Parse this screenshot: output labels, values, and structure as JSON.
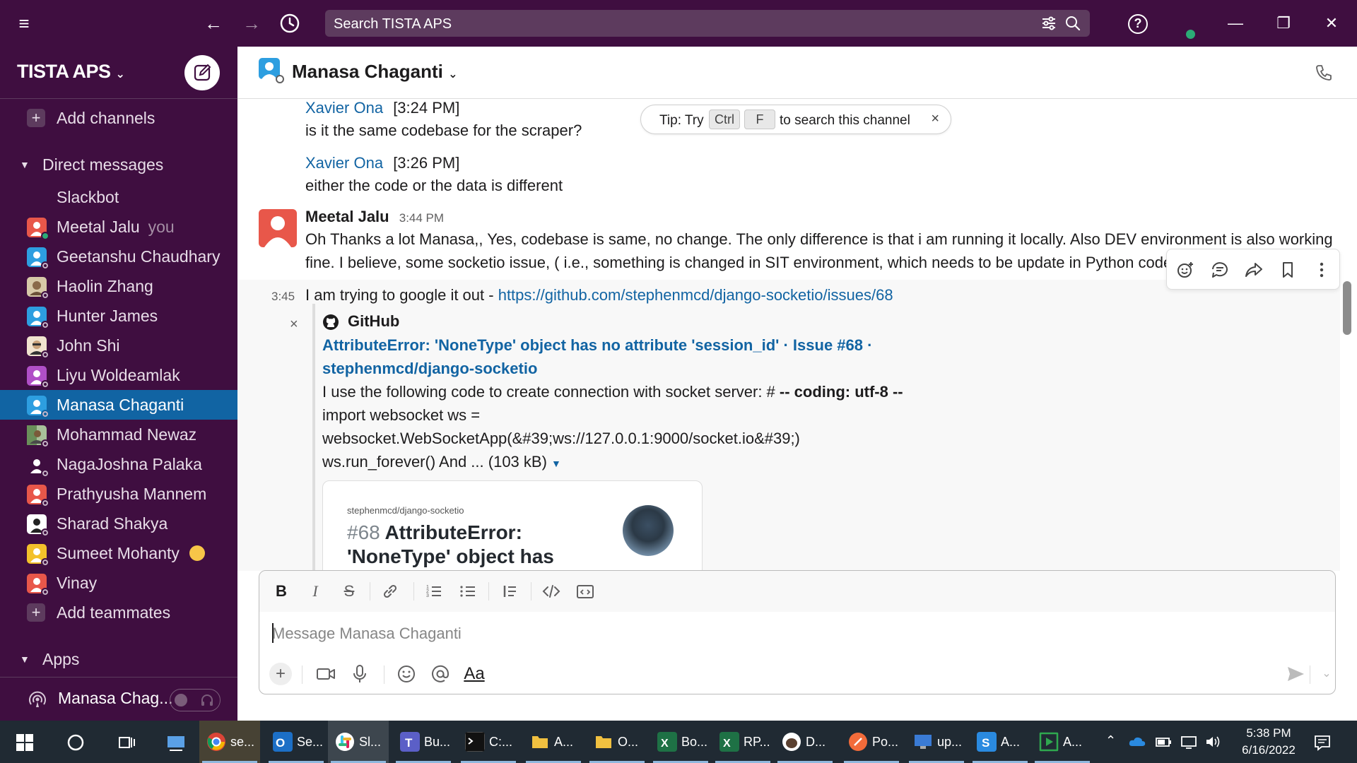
{
  "topbar": {
    "search_placeholder": "Search TISTA APS",
    "help_label": "?"
  },
  "sidebar": {
    "workspace_name": "TISTA APS",
    "add_channels": "Add channels",
    "dm_section": "Direct messages",
    "dms": [
      {
        "name": "Slackbot"
      },
      {
        "name": "Meetal Jalu",
        "suffix": "you",
        "color": "#e8574a"
      },
      {
        "name": "Geetanshu Chaudhary",
        "color": "#2d9ee0"
      },
      {
        "name": "Haolin Zhang",
        "color": "#d7c9a8"
      },
      {
        "name": "Hunter James",
        "color": "#2d9ee0"
      },
      {
        "name": "John Shi",
        "color": "#c9a27a"
      },
      {
        "name": "Liyu Woldeamlak",
        "color": "#b04fc7"
      },
      {
        "name": "Manasa Chaganti",
        "color": "#2d9ee0"
      },
      {
        "name": "Mohammad Newaz",
        "color": "#6a8f5a"
      },
      {
        "name": "NagaJoshna Palaka",
        "color": "#222222"
      },
      {
        "name": "Prathyusha Mannem",
        "color": "#e8574a"
      },
      {
        "name": "Sharad Shakya",
        "color": "#222222"
      },
      {
        "name": "Sumeet Mohanty",
        "color": "#f3c12b"
      },
      {
        "name": "Vinay",
        "color": "#e8574a"
      }
    ],
    "add_teammates": "Add teammates",
    "apps_section": "Apps",
    "footer_name": "Manasa Chag..."
  },
  "channel": {
    "title": "Manasa Chaganti"
  },
  "tip": {
    "prefix": "Tip: Try",
    "key1": "Ctrl",
    "key2": "F",
    "suffix": "to search this channel",
    "close": "×"
  },
  "messages": {
    "m1": {
      "author": "Xavier Ona",
      "time": "[3:24 PM]",
      "text": "is it the same codebase for the scraper?"
    },
    "m2": {
      "author": "Xavier Ona",
      "time": "[3:26 PM]",
      "text": "either the code or the data is different"
    },
    "m3": {
      "author": "Meetal Jalu",
      "time": "3:44 PM",
      "line1": "Oh Thanks a lot Manasa,, Yes, codebase is same, no change. The only difference is that i am running it locally. Also DEV environment is also working",
      "line2": "fine. I believe, some socketio issue, ( i.e., something is changed in SIT environment, which needs to be update in Python code"
    },
    "m4": {
      "time": "3:45",
      "text_prefix": "I am trying to google it out - ",
      "link": "https://github.com/stephenmcd/django-socketio/issues/68",
      "dismiss": "×",
      "unfurl": {
        "source": "GitHub",
        "title_line1": "AttributeError: 'NoneType' object has no attribute 'session_id' · Issue #68 ·",
        "title_line2": "stephenmcd/django-socketio",
        "desc_line1_prefix": "I use the following code to create connection with socket server: # ",
        "desc_line1_bold": "-- coding: utf-8 --",
        "desc_line2": "import websocket ws =",
        "desc_line3": "websocket.WebSocketApp(&#39;ws://127.0.0.1:9000/socket.io&#39;)",
        "desc_line4": "ws.run_forever() And ... (103 kB)",
        "card_repo": "stephenmcd/django-socketio",
        "card_num": "#68",
        "card_title_a": " AttributeError:",
        "card_title_b": "'NoneType' object has"
      }
    }
  },
  "composer": {
    "placeholder": "Message Manasa Chaganti",
    "aa_label": "Aa"
  },
  "taskbar": {
    "items": [
      {
        "label": "se...",
        "color": "#e8a43a"
      },
      {
        "label": "Se...",
        "color": "#1c6fc6"
      },
      {
        "label": "Sl...",
        "color": "#ffffff"
      },
      {
        "label": "Bu...",
        "color": "#5b5fc7"
      },
      {
        "label": "C:...",
        "color": "#111111"
      },
      {
        "label": "A...",
        "color": "#f0c040"
      },
      {
        "label": "O...",
        "color": "#f0c040"
      },
      {
        "label": "Bo...",
        "color": "#1e7145"
      },
      {
        "label": "RP...",
        "color": "#1e7145"
      },
      {
        "label": "D...",
        "color": "#ffffff"
      },
      {
        "label": "Po...",
        "color": "#f26b3a"
      },
      {
        "label": "up...",
        "color": "#3a7bd5"
      },
      {
        "label": "A...",
        "color": "#2a8ae0"
      },
      {
        "label": "A...",
        "color": "#2fa84f"
      }
    ],
    "time": "5:38 PM",
    "date": "6/16/2022"
  }
}
